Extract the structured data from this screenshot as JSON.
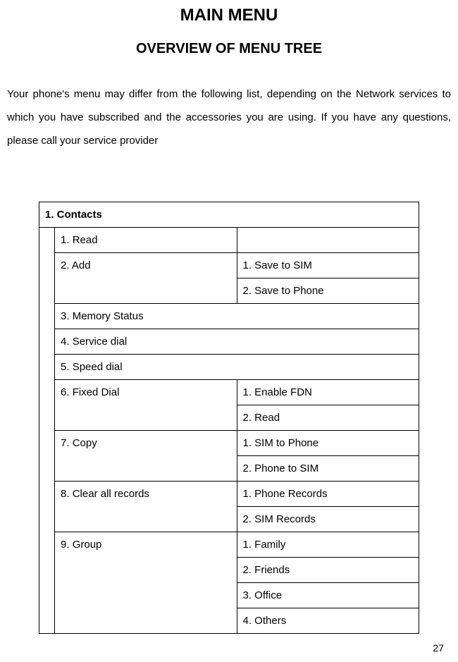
{
  "title": "MAIN MENU",
  "subtitle": "OVERVIEW OF MENU TREE",
  "intro": "Your phone's menu may differ from the following list, depending on the Network services to which you have subscribed and the accessories you are using. If you have any questions, please call your service provider",
  "section_header": "1. Contacts",
  "rows": {
    "r1": "1. Read",
    "r2": "2. Add",
    "r2a": "1. Save to SIM",
    "r2b": "2. Save to Phone",
    "r3": "3. Memory Status",
    "r4": "4. Service dial",
    "r5": "5. Speed dial",
    "r6": "6. Fixed Dial",
    "r6a": "1. Enable FDN",
    "r6b": "2. Read",
    "r7": "7. Copy",
    "r7a": "1. SIM to Phone",
    "r7b": "2. Phone to SIM",
    "r8": "8. Clear all records",
    "r8a": "1. Phone Records",
    "r8b": "2. SIM Records",
    "r9": "9. Group",
    "r9a": "1. Family",
    "r9b": "2. Friends",
    "r9c": "3. Office",
    "r9d": "4. Others"
  },
  "page_number": "27"
}
